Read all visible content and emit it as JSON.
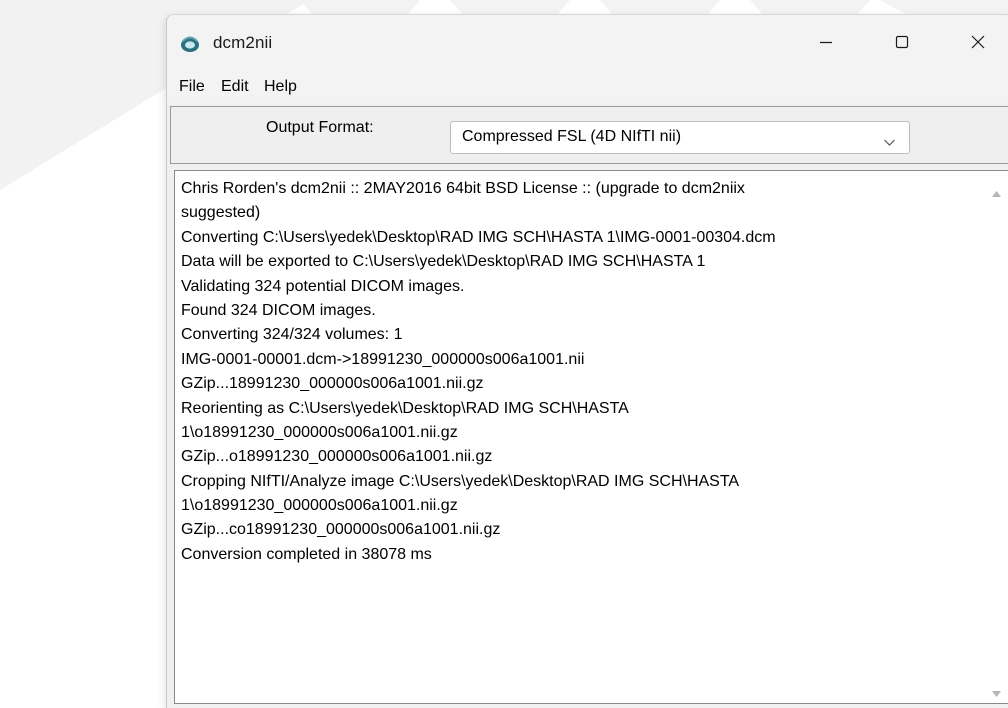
{
  "window": {
    "title": "dcm2nii",
    "app_icon": "dcm2nii-app-icon",
    "controls": {
      "minimize_icon": "minimize-icon",
      "maximize_icon": "maximize-icon",
      "close_icon": "close-icon"
    }
  },
  "menu": {
    "items": [
      {
        "label": "File"
      },
      {
        "label": "Edit"
      },
      {
        "label": "Help"
      }
    ]
  },
  "output_format": {
    "label": "Output Format:",
    "selected": "Compressed FSL (4D NIfTI nii)",
    "dropdown_icon": "chevron-down-icon"
  },
  "log": {
    "lines": [
      "Chris Rorden's dcm2nii :: 2MAY2016 64bit BSD License  :: (upgrade to dcm2niix",
      "suggested)",
      "Converting C:\\Users\\yedek\\Desktop\\RAD IMG SCH\\HASTA 1\\IMG-0001-00304.dcm",
      "Data will be exported to C:\\Users\\yedek\\Desktop\\RAD IMG SCH\\HASTA 1",
      "Validating 324 potential DICOM images.",
      "Found 324 DICOM images.",
      "Converting 324/324  volumes: 1",
      "IMG-0001-00001.dcm->18991230_000000s006a1001.nii",
      "GZip...18991230_000000s006a1001.nii.gz",
      "Reorienting as C:\\Users\\yedek\\Desktop\\RAD IMG SCH\\HASTA",
      "1\\o18991230_000000s006a1001.nii.gz",
      "GZip...o18991230_000000s006a1001.nii.gz",
      "Cropping NIfTI/Analyze image C:\\Users\\yedek\\Desktop\\RAD IMG SCH\\HASTA",
      "1\\o18991230_000000s006a1001.nii.gz",
      "GZip...co18991230_000000s006a1001.nii.gz",
      "Conversion completed in 38078 ms"
    ],
    "scroll_up_icon": "scroll-up-arrow-icon",
    "scroll_down_icon": "scroll-down-arrow-icon"
  },
  "colors": {
    "watermark": "#ececec",
    "window_bg": "#f0f0f0",
    "log_bg": "#ffffff"
  }
}
